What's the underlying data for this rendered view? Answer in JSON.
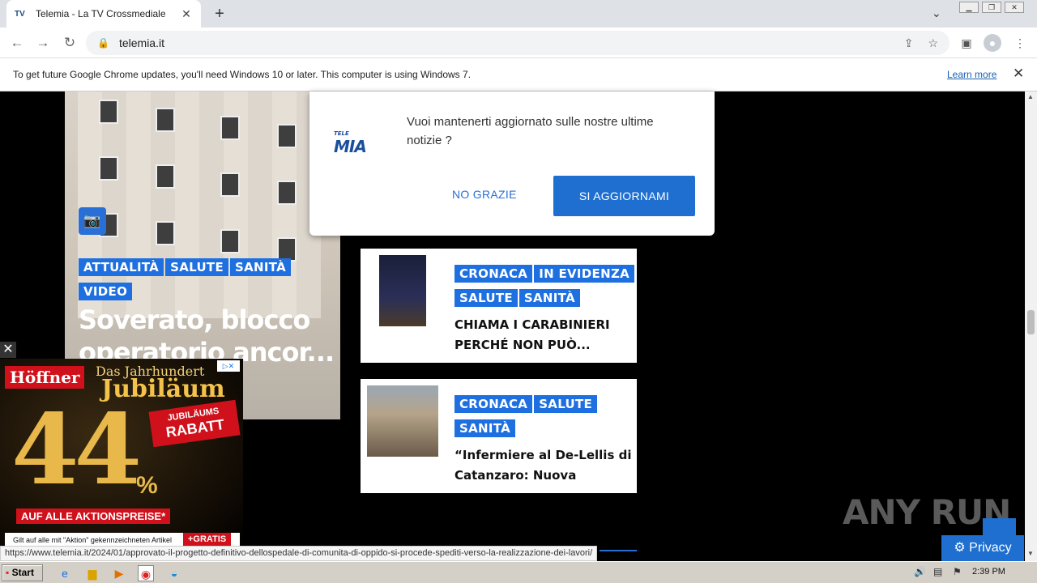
{
  "browser": {
    "tab_title": "Telemia - La TV Crossmediale",
    "tab_close": "✕",
    "new_tab": "+",
    "url": "telemia.it",
    "infobar_text": "To get future Google Chrome updates, you'll need Windows 10 or later. This computer is using Windows 7.",
    "infobar_link": "Learn more",
    "infobar_close": "✕"
  },
  "popup": {
    "logo_small": "TELE",
    "logo": "MIA",
    "message": "Vuoi mantenerti aggiornato sulle nostre ultime notizie ?",
    "no_label": "NO GRAZIE",
    "yes_label": "SI AGGIORNAMI"
  },
  "hero": {
    "tags": [
      "ATTUALITÀ",
      "SALUTE",
      "SANITÀ",
      "VIDEO"
    ],
    "title": "Soverato, blocco operatorio ancor..."
  },
  "cards": [
    {
      "tags": [
        "CRONACA",
        "IN EVIDENZA",
        "SALUTE",
        "SANITÀ"
      ],
      "title": "CHIAMA I CARABINIERI PERCHÉ NON PUÒ..."
    },
    {
      "tags": [
        "CRONACA",
        "SALUTE",
        "SANITÀ"
      ],
      "title": "“Infermiere al De-Lellis di Catanzaro: Nuova Arrest..."
    }
  ],
  "ad": {
    "brand": "Höffner",
    "headline": "Das Jahrhundert",
    "subheadline": "Jubiläum",
    "percent": "44",
    "percent_sign": "%",
    "badge_top": "JUBILÄUMS",
    "badge_main": "RABATT",
    "alle": "AUF ALLE AKTIONSPREISE*",
    "fineprint": "Gilt auf alle mit \"Aktion\" gekennzeichneten Artikel",
    "gratis": "+GRATIS",
    "close": "✕"
  },
  "status_url": "https://www.telemia.it/2024/01/approvato-il-progetto-definitivo-dellospedale-di-comunita-di-oppido-si-procede-spediti-verso-la-realizzazione-dei-lavori/",
  "privacy_label": "Privacy",
  "watermark": "ANY RUN",
  "taskbar": {
    "start": "Start",
    "clock": "2:39 PM"
  },
  "colors": {
    "accent": "#1e6fd0",
    "tag": "#1e6fe0",
    "ad_red": "#d0111b"
  }
}
